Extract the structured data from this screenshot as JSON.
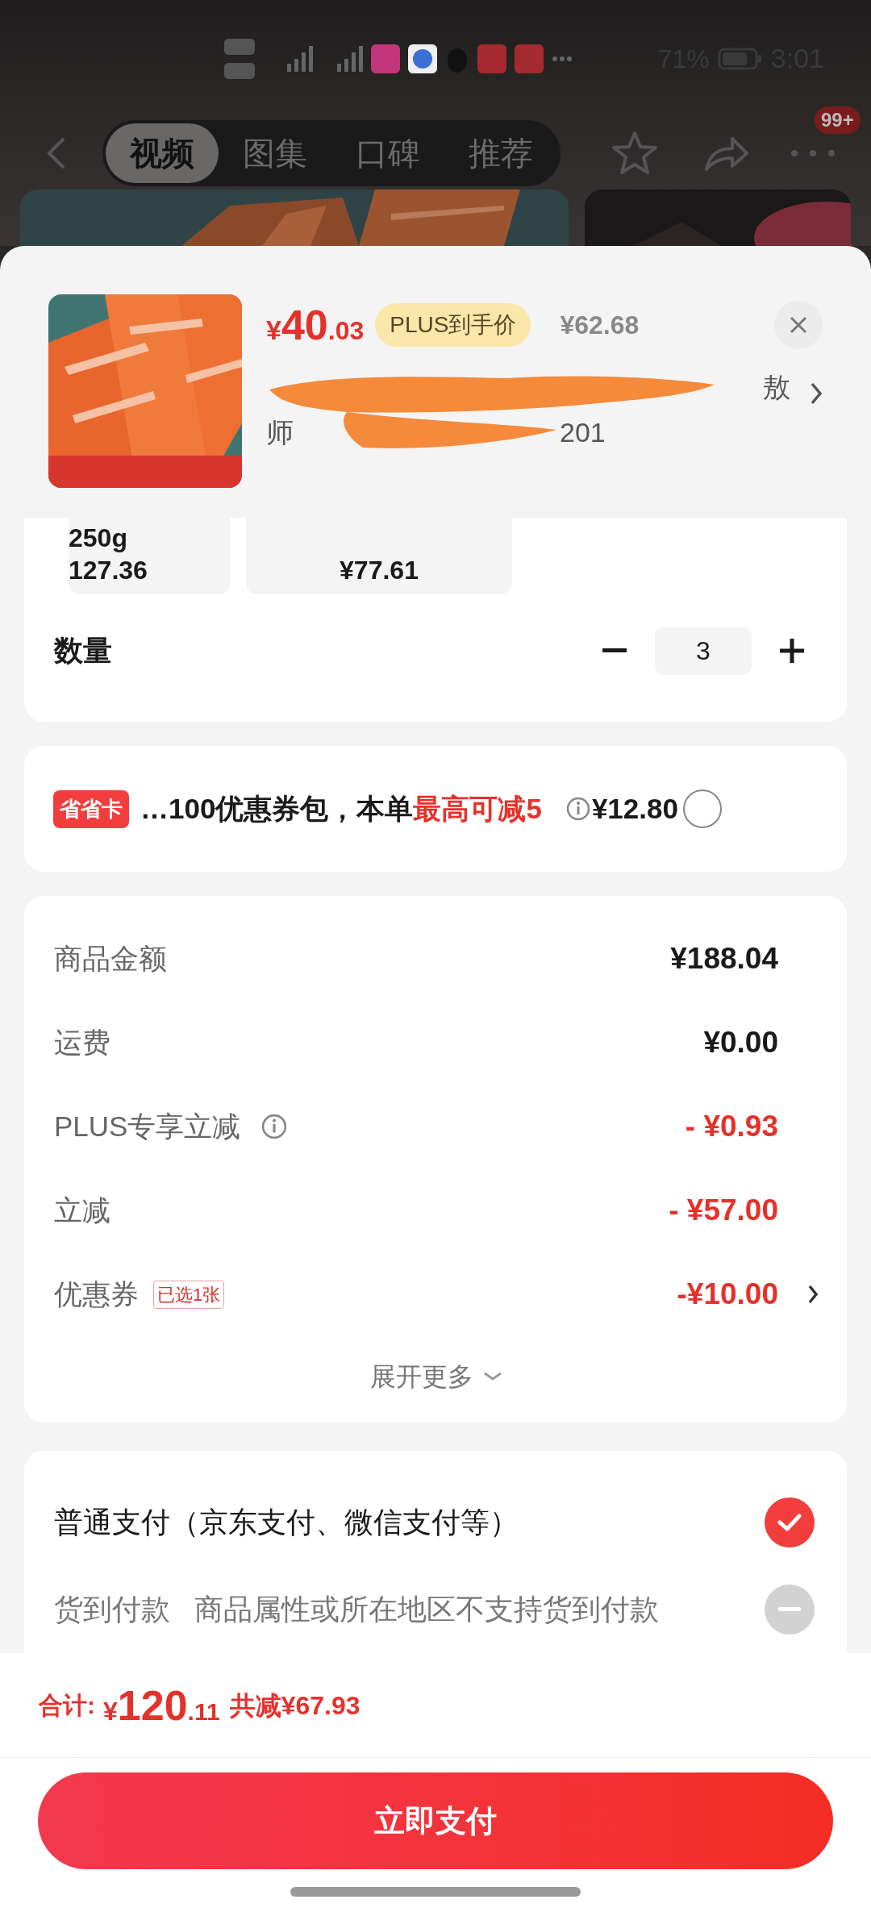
{
  "status_bar": {
    "battery": "71%",
    "time": "3:01"
  },
  "nav": {
    "tabs": [
      {
        "label": "视频",
        "selected": true
      },
      {
        "label": "图集",
        "selected": false
      },
      {
        "label": "口碑",
        "selected": false
      },
      {
        "label": "推荐",
        "selected": false
      }
    ],
    "badge": "99+"
  },
  "product": {
    "currency": "¥",
    "price_main": "40",
    "price_decimal": ".03",
    "price_tag": "PLUS到手价",
    "original_price": "¥62.68",
    "title_line_1_end": "敖",
    "title_line_2_start": "师",
    "title_line_2_end": "201"
  },
  "specs": [
    {
      "lines": [
        "250g",
        "127.36"
      ]
    },
    {
      "lines": [
        "¥77.61"
      ]
    }
  ],
  "quantity": {
    "label": "数量",
    "value": "3"
  },
  "offer": {
    "badge": "省省卡",
    "text": "…100优惠券包，本单",
    "highlight": "最高可减5",
    "price": "¥12.80",
    "checked": false
  },
  "summary": {
    "rows": [
      {
        "label": "商品金额",
        "value": "¥188.04",
        "kind": "amount"
      },
      {
        "label": "运费",
        "value": "¥0.00",
        "kind": "amount"
      },
      {
        "label": "PLUS专享立减",
        "value": "- ¥0.93",
        "kind": "discount",
        "info": true
      },
      {
        "label": "立减",
        "value": "- ¥57.00",
        "kind": "discount"
      },
      {
        "label": "优惠券",
        "tag": "已选1张",
        "value": "-¥10.00",
        "kind": "discount",
        "chevron": true
      }
    ],
    "expand": "展开更多"
  },
  "payment": [
    {
      "label": "普通支付（京东支付、微信支付等）",
      "selected": true,
      "disabled": false
    },
    {
      "label": "货到付款",
      "note": "商品属性或所在地区不支持货到付款",
      "selected": false,
      "disabled": true
    }
  ],
  "footer": {
    "total_label": "合计:",
    "currency": "¥",
    "total_main": "120",
    "total_decimal": ".11",
    "saved": "共减¥67.93",
    "button": "立即支付"
  }
}
